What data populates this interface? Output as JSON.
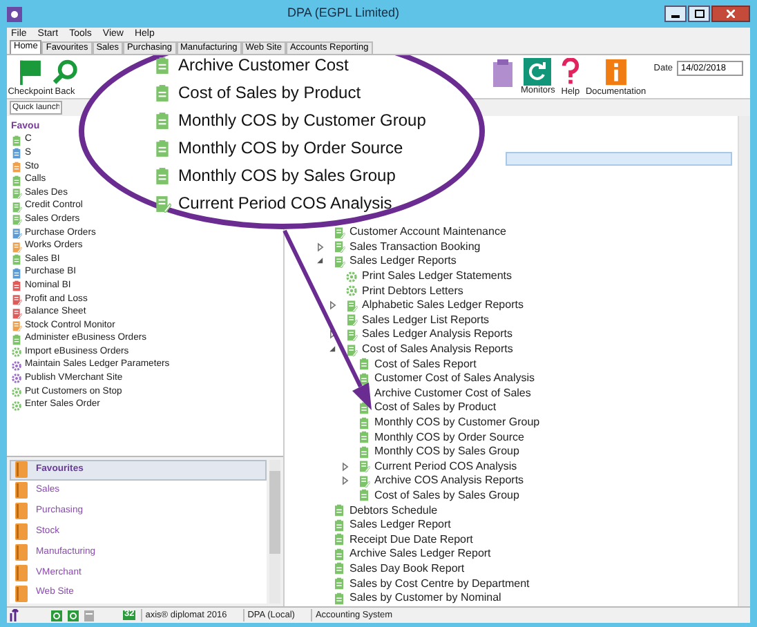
{
  "window": {
    "title": "DPA (EGPL Limited)"
  },
  "menu": [
    "File",
    "Start",
    "Tools",
    "View",
    "Help"
  ],
  "tabs": [
    {
      "label": "Home",
      "selected": true
    },
    {
      "label": "Favourites",
      "selected": false
    },
    {
      "label": "Sales",
      "selected": false
    },
    {
      "label": "Purchasing",
      "selected": false
    },
    {
      "label": "Manufacturing",
      "selected": false
    },
    {
      "label": "Web Site",
      "selected": false
    },
    {
      "label": "Accounts Reporting",
      "selected": false
    }
  ],
  "ribbon_left": [
    {
      "label": "Checkpoint",
      "kind": "flag"
    },
    {
      "label": "Back",
      "kind": "search"
    }
  ],
  "ribbon_right": [
    {
      "kind": "clipboard"
    },
    {
      "label": "Monitors",
      "kind": "refresh"
    },
    {
      "label": "Help",
      "kind": "help"
    },
    {
      "label": "Documentation",
      "kind": "info"
    }
  ],
  "date": {
    "label": "Date",
    "value": "14/02/2018"
  },
  "quick_launch": {
    "placeholder": "Quick launch"
  },
  "favourites": {
    "title": "Favou",
    "items": [
      {
        "label": "C",
        "kind": "report",
        "color": "#7cc36a"
      },
      {
        "label": "S",
        "kind": "report",
        "color": "#5b9bd5"
      },
      {
        "label": "Sto",
        "kind": "report",
        "color": "#f0a04b"
      },
      {
        "label": "Calls",
        "kind": "report",
        "color": "#7cc36a"
      },
      {
        "label": "Sales Des",
        "kind": "form",
        "color": "#7cc36a"
      },
      {
        "label": "Credit Control",
        "kind": "form",
        "color": "#7cc36a"
      },
      {
        "label": "Sales Orders",
        "kind": "form",
        "color": "#7cc36a"
      },
      {
        "label": "Purchase Orders",
        "kind": "form",
        "color": "#5b9bd5"
      },
      {
        "label": "Works Orders",
        "kind": "form",
        "color": "#f0a04b"
      },
      {
        "label": "Sales BI",
        "kind": "report",
        "color": "#7cc36a"
      },
      {
        "label": "Purchase BI",
        "kind": "report",
        "color": "#5b9bd5"
      },
      {
        "label": "Nominal BI",
        "kind": "report",
        "color": "#e05a5a"
      },
      {
        "label": "Profit and Loss",
        "kind": "form",
        "color": "#e05a5a"
      },
      {
        "label": "Balance Sheet",
        "kind": "form",
        "color": "#e05a5a"
      },
      {
        "label": "Stock Control Monitor",
        "kind": "form",
        "color": "#f0a04b"
      },
      {
        "label": "Administer eBusiness Orders",
        "kind": "report",
        "color": "#7cc36a"
      },
      {
        "label": "Import eBusiness Orders",
        "kind": "process",
        "color": "#7cc36a"
      },
      {
        "label": "Maintain Sales Ledger Parameters",
        "kind": "process",
        "color": "#9b6bc8"
      },
      {
        "label": "Publish VMerchant Site",
        "kind": "process",
        "color": "#9b6bc8"
      },
      {
        "label": "Put Customers on Stop",
        "kind": "process",
        "color": "#7cc36a"
      },
      {
        "label": "Enter Sales Order",
        "kind": "process",
        "color": "#7cc36a"
      }
    ]
  },
  "navigation": [
    {
      "label": "Favourites",
      "selected": true
    },
    {
      "label": "Sales",
      "selected": false
    },
    {
      "label": "Purchasing",
      "selected": false
    },
    {
      "label": "Stock",
      "selected": false
    },
    {
      "label": "Manufacturing",
      "selected": false
    },
    {
      "label": "VMerchant",
      "selected": false
    },
    {
      "label": "Web Site",
      "selected": false
    }
  ],
  "tree": [
    {
      "label": "Customer Account Maintenance",
      "kind": "form"
    },
    {
      "label": "Sales Transaction Booking",
      "kind": "form",
      "expanded": false
    },
    {
      "label": "Sales Ledger Reports",
      "kind": "form",
      "expanded": true,
      "children": [
        {
          "label": "Print Sales Ledger Statements",
          "kind": "process"
        },
        {
          "label": "Print Debtors Letters",
          "kind": "process"
        },
        {
          "label": "Alphabetic Sales Ledger Reports",
          "kind": "form",
          "expanded": false
        },
        {
          "label": "Sales Ledger List Reports",
          "kind": "form"
        },
        {
          "label": "Sales Ledger Analysis Reports",
          "kind": "form",
          "expanded": false
        },
        {
          "label": "Cost of Sales Analysis Reports",
          "kind": "form",
          "expanded": true,
          "children": [
            {
              "label": "Cost of Sales Report",
              "kind": "report"
            },
            {
              "label": "Customer Cost of Sales Analysis",
              "kind": "report"
            },
            {
              "label": "Archive Customer Cost of Sales",
              "kind": "report"
            },
            {
              "label": "Cost of Sales by Product",
              "kind": "report"
            },
            {
              "label": "Monthly COS by Customer Group",
              "kind": "report"
            },
            {
              "label": "Monthly COS by Order Source",
              "kind": "report"
            },
            {
              "label": "Monthly COS by Sales Group",
              "kind": "report"
            },
            {
              "label": "Current Period COS Analysis",
              "kind": "form",
              "expanded": false
            },
            {
              "label": "Archive COS Analysis Reports",
              "kind": "form",
              "expanded": false
            },
            {
              "label": "Cost of Sales by Sales Group",
              "kind": "report"
            }
          ]
        }
      ]
    },
    {
      "label": "Debtors Schedule",
      "kind": "report"
    },
    {
      "label": "Sales Ledger Report",
      "kind": "report"
    },
    {
      "label": "Receipt Due Date Report",
      "kind": "report"
    },
    {
      "label": "Archive Sales Ledger Report",
      "kind": "report"
    },
    {
      "label": "Sales Day Book Report",
      "kind": "report"
    },
    {
      "label": "Sales by Cost Centre by Department",
      "kind": "report"
    },
    {
      "label": "Sales by Customer by Nominal",
      "kind": "report"
    }
  ],
  "callout": [
    {
      "label": "Archive Customer Cost",
      "kind": "report"
    },
    {
      "label": "Cost of Sales by Product",
      "kind": "report"
    },
    {
      "label": "Monthly COS by Customer Group",
      "kind": "report"
    },
    {
      "label": "Monthly COS by Order Source",
      "kind": "report"
    },
    {
      "label": "Monthly COS by Sales Group",
      "kind": "report"
    },
    {
      "label": "Current Period COS Analysis",
      "kind": "form"
    }
  ],
  "status_bar": {
    "badge": "32",
    "product": "axis® diplomat 2016",
    "database": "DPA (Local)",
    "system": "Accounting System"
  }
}
